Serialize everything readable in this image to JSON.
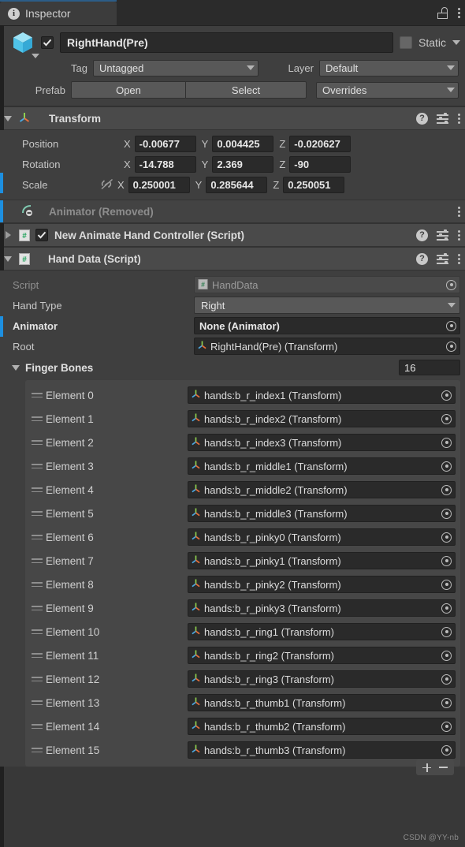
{
  "window": {
    "tab_label": "Inspector",
    "tab_icon": "info-icon",
    "lock_icon": "lock-icon",
    "menu_icon": "kebab-menu-icon",
    "accent_color": "#2c5d87"
  },
  "gameobject": {
    "icon": "prefab-cube-icon",
    "enabled": true,
    "name": "RightHand(Pre)",
    "static_label": "Static",
    "static_checked": false,
    "tag_label": "Tag",
    "tag_value": "Untagged",
    "layer_label": "Layer",
    "layer_value": "Default",
    "prefab_label": "Prefab",
    "open_label": "Open",
    "select_label": "Select",
    "overrides_label": "Overrides"
  },
  "transform": {
    "title": "Transform",
    "icon": "transform-axis-icon",
    "help_icon": "help-icon",
    "preset_icon": "preset-icon",
    "menu_icon": "kebab-menu-icon",
    "rows": [
      {
        "label": "Position",
        "x": "-0.00677",
        "y": "0.004425",
        "z": "-0.020627"
      },
      {
        "label": "Rotation",
        "x": "-14.788",
        "y": "2.369",
        "z": "-90"
      },
      {
        "label": "Scale",
        "x": "0.250001",
        "y": "0.285644",
        "z": "0.250051"
      }
    ],
    "axis_x": "X",
    "axis_y": "Y",
    "axis_z": "Z",
    "scale_link_icon": "broken-link-icon"
  },
  "animator_removed": {
    "title": "Animator (Removed)",
    "icon": "animator-removed-icon",
    "menu_icon": "kebab-menu-icon"
  },
  "animate_hand_controller": {
    "title": "New Animate Hand Controller (Script)",
    "icon": "cs-script-icon",
    "enabled": true,
    "expanded": false
  },
  "hand_data": {
    "title": "Hand Data (Script)",
    "icon": "cs-script-icon",
    "expanded": true,
    "fields": [
      {
        "label": "Script",
        "value": "HandData",
        "type": "object-readonly",
        "icon": "cs-script-icon"
      },
      {
        "label": "Hand Type",
        "value": "Right",
        "type": "dropdown"
      },
      {
        "label": "Animator",
        "value": "None (Animator)",
        "type": "object",
        "bold": true
      },
      {
        "label": "Root",
        "value": "RightHand(Pre) (Transform)",
        "type": "object",
        "icon": "transform-axis-icon"
      }
    ],
    "finger_bones": {
      "label": "Finger Bones",
      "size": "16",
      "element_label_prefix": "Element",
      "elements": [
        {
          "index": "Element 0",
          "value": "hands:b_r_index1 (Transform)"
        },
        {
          "index": "Element 1",
          "value": "hands:b_r_index2 (Transform)"
        },
        {
          "index": "Element 2",
          "value": "hands:b_r_index3 (Transform)"
        },
        {
          "index": "Element 3",
          "value": "hands:b_r_middle1 (Transform)"
        },
        {
          "index": "Element 4",
          "value": "hands:b_r_middle2 (Transform)"
        },
        {
          "index": "Element 5",
          "value": "hands:b_r_middle3 (Transform)"
        },
        {
          "index": "Element 6",
          "value": "hands:b_r_pinky0 (Transform)"
        },
        {
          "index": "Element 7",
          "value": "hands:b_r_pinky1 (Transform)"
        },
        {
          "index": "Element 8",
          "value": "hands:b_r_pinky2 (Transform)"
        },
        {
          "index": "Element 9",
          "value": "hands:b_r_pinky3 (Transform)"
        },
        {
          "index": "Element 10",
          "value": "hands:b_r_ring1 (Transform)"
        },
        {
          "index": "Element 11",
          "value": "hands:b_r_ring2 (Transform)"
        },
        {
          "index": "Element 12",
          "value": "hands:b_r_ring3 (Transform)"
        },
        {
          "index": "Element 13",
          "value": "hands:b_r_thumb1 (Transform)"
        },
        {
          "index": "Element 14",
          "value": "hands:b_r_thumb2 (Transform)"
        },
        {
          "index": "Element 15",
          "value": "hands:b_r_thumb3 (Transform)"
        }
      ],
      "add_button": "add-element-button",
      "remove_button": "remove-element-button"
    }
  },
  "watermark": {
    "text": "CSDN @YY-nb"
  },
  "colors": {
    "background": "#383838",
    "panel": "#3f3f3f",
    "header": "#4a4a4a",
    "field": "#2a2a2a",
    "override_marker": "#1d8fe0",
    "text": "#c4c4c4"
  }
}
